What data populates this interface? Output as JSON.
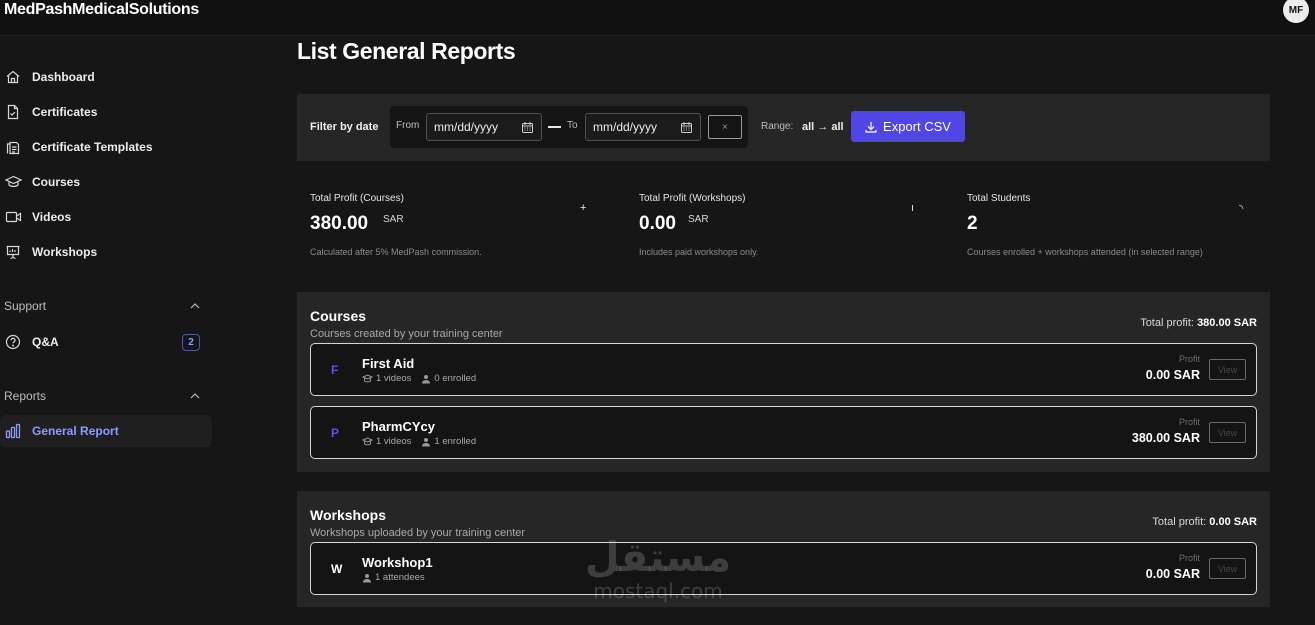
{
  "app": {
    "brand": "MedPashMedicalSolutions",
    "user_initials": "MF",
    "accent": "#5046e5",
    "link_color": "#8f9cff"
  },
  "sidebar": {
    "items": [
      {
        "label": "Dashboard",
        "icon": "home-icon"
      },
      {
        "label": "Certificates",
        "icon": "document-check-icon"
      },
      {
        "label": "Certificate Templates",
        "icon": "documents-icon"
      },
      {
        "label": "Courses",
        "icon": "graduation-cap-icon"
      },
      {
        "label": "Videos",
        "icon": "video-icon"
      },
      {
        "label": "Workshops",
        "icon": "presentation-icon"
      }
    ],
    "support": {
      "heading": "Support",
      "items": [
        {
          "label": "Q&A",
          "icon": "question-circle-icon",
          "badge": "2"
        }
      ]
    },
    "reports": {
      "heading": "Reports",
      "items": [
        {
          "label": "General Report",
          "icon": "bar-chart-icon",
          "active": true
        }
      ]
    }
  },
  "page": {
    "title": "List General Reports"
  },
  "filter": {
    "label": "Filter by date",
    "from_label": "From",
    "from_placeholder": "mm/dd/yyyy",
    "to_label": "To",
    "to_placeholder": "mm/dd/yyyy",
    "clear": "×",
    "range_label": "Range:",
    "range_value": "all → all",
    "export_label": "Export CSV"
  },
  "stats": [
    {
      "label": "Total Profit (Courses)",
      "value": "380.00",
      "currency": "SAR",
      "note": "Calculated after 5% MedPash commission.",
      "marker": "+"
    },
    {
      "label": "Total Profit (Workshops)",
      "value": "0.00",
      "currency": "SAR",
      "note": "Includes paid workshops only.",
      "marker": "ı"
    },
    {
      "label": "Total Students",
      "value": "2",
      "note": "Courses enrolled + workshops attended (in selected range)",
      "marker": "◝"
    }
  ],
  "courses": {
    "title": "Courses",
    "subtitle": "Courses created by your training center",
    "total_label": "Total profit:",
    "total_value": "380.00 SAR",
    "items": [
      {
        "letter": "F",
        "name": "First Aid",
        "videos": "1 videos",
        "people": "0 enrolled",
        "profit_label": "Profit",
        "profit": "0.00 SAR",
        "view": "View"
      },
      {
        "letter": "P",
        "name": "PharmCYcy",
        "videos": "1 videos",
        "people": "1 enrolled",
        "profit_label": "Profit",
        "profit": "380.00 SAR",
        "view": "View"
      }
    ]
  },
  "workshops": {
    "title": "Workshops",
    "subtitle": "Workshops uploaded by your training center",
    "total_label": "Total profit:",
    "total_value": "0.00 SAR",
    "items": [
      {
        "letter": "W",
        "name": "Workshop1",
        "people": "1 attendees",
        "profit_label": "Profit",
        "profit": "0.00 SAR",
        "view": "View"
      }
    ]
  },
  "watermark": {
    "arabic": "مستقل",
    "latin": "mostaql.com"
  }
}
